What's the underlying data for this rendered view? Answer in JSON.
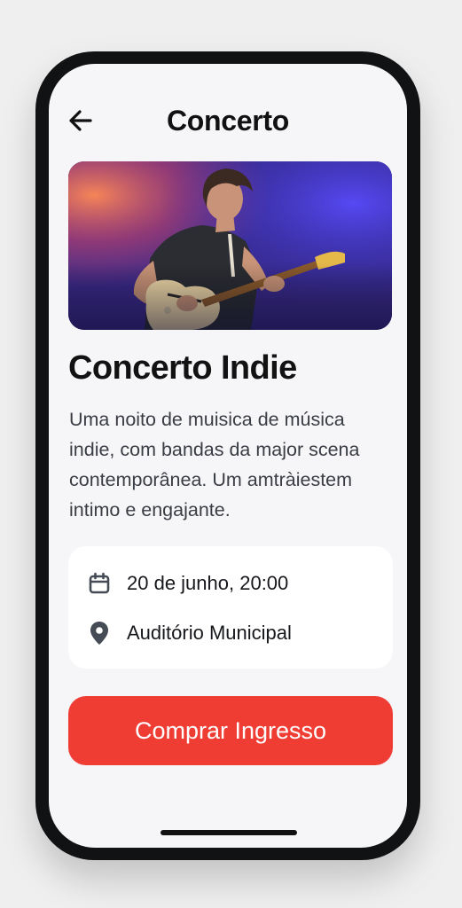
{
  "header": {
    "title": "Concerto",
    "back_icon": "arrow-left-icon"
  },
  "hero": {
    "image_description_icon": "concert-photo",
    "colors": {
      "warm": "#c8446a",
      "cool": "#2c2fb2"
    }
  },
  "event": {
    "title": "Concerto Indie",
    "description": "Uma noito de muisica de música indie, com bandas da major scena contemporânea. Um amtràiestem intimo e engajante."
  },
  "details": {
    "date_icon": "calendar-icon",
    "date": "20 de junho, 20:00",
    "location_icon": "location-pin-icon",
    "location": "Auditório Municipal"
  },
  "cta": {
    "label": "Comprar Ingresso",
    "color": "#ef3d34"
  }
}
